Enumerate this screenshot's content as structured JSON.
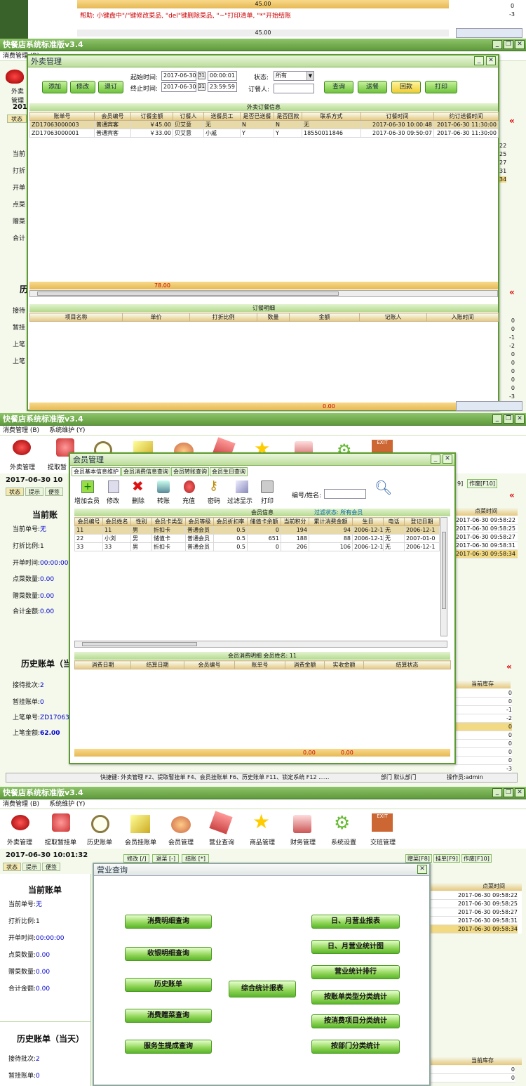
{
  "top_fragment": {
    "amount": "45.00",
    "help_text": "帮助: 小键盘中\"/\"键修改菜品, \"del\"键删除菜品, \"~\"打印清单, \"*\"开始结账",
    "amount2": "45.00",
    "right_nums": [
      "-3",
      "0"
    ]
  },
  "app": {
    "title": "快餐店系统标准版v3.4",
    "menus": [
      "消费管理 (B)",
      "系统维护 (Y)"
    ],
    "toolbar": [
      "外卖管理",
      "提取暂挂单",
      "历史账单",
      "会员挂账单",
      "会员管理",
      "营业查询",
      "商品管理",
      "财务管理",
      "系统设置",
      "交班管理"
    ],
    "datetime": "2017-06-30 10:01:32",
    "side_tabs": [
      "状态",
      "提示",
      "便签"
    ],
    "current_bill": {
      "heading": "当前账单",
      "bill_no_label": "当前单号:",
      "bill_no": "无",
      "discount_label": "打折比例:",
      "discount": "1",
      "open_time_label": "开单时间:",
      "open_time": "00:00:00",
      "dish_count_label": "点菜数量:",
      "dish_count": "0.00",
      "gift_count_label": "赠菜数量:",
      "gift_count": "0.00",
      "total_label": "合计金额:",
      "total": "0.00"
    },
    "history_bill": {
      "heading": "历史账单（当天）",
      "batches_label": "接待批次:",
      "batches": "2",
      "hold_label": "暂挂账单:",
      "hold": "0",
      "last_no_label": "上笔单号:",
      "last_no": "ZD17063",
      "last_amount_label": "上笔金额:",
      "last_amount": "62.00"
    },
    "right_tabs": [
      "修改 [/]",
      "退菜 [-]",
      "结账 [*]"
    ],
    "right_tabs2": [
      "赠菜[F8]",
      "挂单[F9]",
      "作废[F10]"
    ],
    "time_header": "点菜时间",
    "times": [
      "2017-06-30 09:58:22",
      "2017-06-30 09:58:25",
      "2017-06-30 09:58:27",
      "2017-06-30 09:58:31",
      "2017-06-30 09:58:34"
    ],
    "stock_header": "当前库存",
    "stock": [
      "0",
      "0",
      "-1",
      "-2",
      "0",
      "0",
      "0",
      "0",
      "0",
      "-3"
    ],
    "statusbar": {
      "shortcuts": "快捷键: 外卖管理 F2、提取暂挂单 F4、会员挂账单 F6、历史账单 F11、锁定系统 F12 ......",
      "dept": "部门 默认部门",
      "operator": "操作员:admin"
    }
  },
  "takeout": {
    "title": "外卖管理",
    "buttons": [
      "添加",
      "修改",
      "退订",
      "查询",
      "送餐",
      "回款",
      "打印"
    ],
    "start_label": "起始时间:",
    "start_date": "2017-06-30",
    "start_time": "00:00:01",
    "end_label": "终止时间:",
    "end_date": "2017-06-30",
    "end_time": "23:59:59",
    "status_label": "状态:",
    "status_value": "所有",
    "orderer_label": "订餐人:",
    "orders_title": "外卖订餐信息",
    "columns": [
      "账单号",
      "会员编号",
      "订餐金额",
      "订餐人",
      "送餐员工",
      "是否已送餐",
      "是否回款",
      "联系方式",
      "订餐时间",
      "约订送餐时间"
    ],
    "rows": [
      [
        "ZD17063000003",
        "普通宾客",
        "￥45.00",
        "贝艾意",
        "无",
        "N",
        "N",
        "无",
        "2017-06-30 10:00:48",
        "2017-06-30 11:30:00"
      ],
      [
        "ZD17063000001",
        "普通宾客",
        "￥33.00",
        "贝艾意",
        "小戚",
        "Y",
        "Y",
        "18550011846",
        "2017-06-30 09:50:07",
        "2017-06-30 11:30:00"
      ]
    ],
    "sum": "78.00",
    "detail_title": "订餐明细",
    "detail_columns": [
      "项目名称",
      "单价",
      "打折比例",
      "数量",
      "金额",
      "记账人",
      "入账时间"
    ],
    "detail_sum": "0.00"
  },
  "member": {
    "title": "会员管理",
    "tabs": [
      "会员基本信息维护",
      "会员消费信息查询",
      "会员转账查询",
      "会员生日查询"
    ],
    "tools": [
      "增加会员",
      "修改",
      "删除",
      "转账",
      "充值",
      "密码",
      "过滤显示",
      "打印"
    ],
    "search_label": "编号/姓名:",
    "info_title": "会员信息",
    "filter_label": "过滤状态: 所有会员",
    "columns": [
      "会员编号",
      "会员姓名",
      "性别",
      "会员卡类型",
      "会员等级",
      "会员折扣率",
      "储值卡余额",
      "当前积分",
      "累计消费金额",
      "生日",
      "电话",
      "登记日期"
    ],
    "rows": [
      [
        "11",
        "11",
        "男",
        "折扣卡",
        "普通会员",
        "0.5",
        "0",
        "194",
        "94",
        "2006-12-1",
        "无",
        "2006-12-1"
      ],
      [
        "22",
        "小浏",
        "男",
        "储值卡",
        "普通会员",
        "0.5",
        "651",
        "188",
        "88",
        "2006-12-1",
        "无",
        "2007-01-0"
      ],
      [
        "33",
        "33",
        "男",
        "折扣卡",
        "普通会员",
        "0.5",
        "0",
        "206",
        "106",
        "2006-12-1",
        "无",
        "2006-12-1"
      ]
    ],
    "detail_title": "会员消费明细  会员姓名: 11",
    "detail_columns": [
      "消费日期",
      "结算日期",
      "会员编号",
      "账单号",
      "消费金额",
      "实收金额",
      "结算状态"
    ],
    "sum1": "0.00",
    "sum2": "0.00"
  },
  "business": {
    "title": "营业查询",
    "left_buttons": [
      "消费明细查询",
      "收银明细查询",
      "历史账单",
      "消费赠菜查询",
      "服务生提成查询"
    ],
    "center_button": "综合统计报表",
    "right_buttons": [
      "日、月营业报表",
      "日、月营业统计图",
      "营业统计排行",
      "按账单类型分类统计",
      "按消费项目分类统计",
      "按部门分类统计"
    ]
  },
  "colors": {
    "accent": "#6fc43a",
    "title_bar": "#5e9a3c",
    "selected_row": "#e7d9a8"
  }
}
